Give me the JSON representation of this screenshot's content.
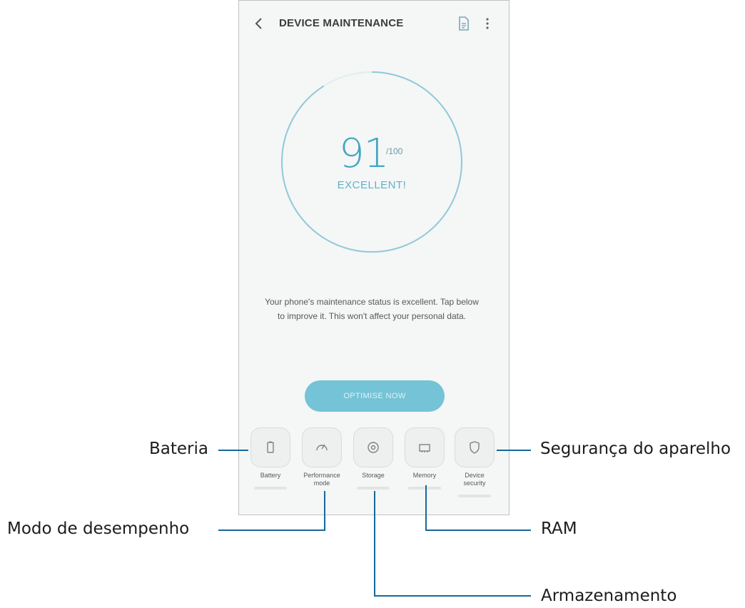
{
  "app": {
    "title": "DEVICE MAINTENANCE",
    "icons": {
      "back": "back-chevron-icon",
      "report": "report-icon",
      "more": "more-options-icon"
    }
  },
  "score": {
    "value": "91",
    "max": "/100",
    "status": "EXCELLENT!",
    "level": 0.91
  },
  "description": "Your phone's maintenance status is excellent. Tap below to improve it. This won't affect your personal data.",
  "optimise_label": "OPTIMISE NOW",
  "items": [
    {
      "label": "Battery",
      "icon": "battery-icon"
    },
    {
      "label": "Performance mode",
      "icon": "speedometer-icon"
    },
    {
      "label": "Storage",
      "icon": "storage-disc-icon"
    },
    {
      "label": "Memory",
      "icon": "memory-chip-icon"
    },
    {
      "label": "Device security",
      "icon": "shield-icon"
    }
  ],
  "callouts": {
    "battery": "Bateria",
    "performance": "Modo de desempenho",
    "storage": "Armazenamento",
    "memory": "RAM",
    "security": "Segurança do aparelho"
  },
  "colors": {
    "accent": "#3fa7c4",
    "button": "#74c3d6",
    "leader": "#15699b"
  }
}
